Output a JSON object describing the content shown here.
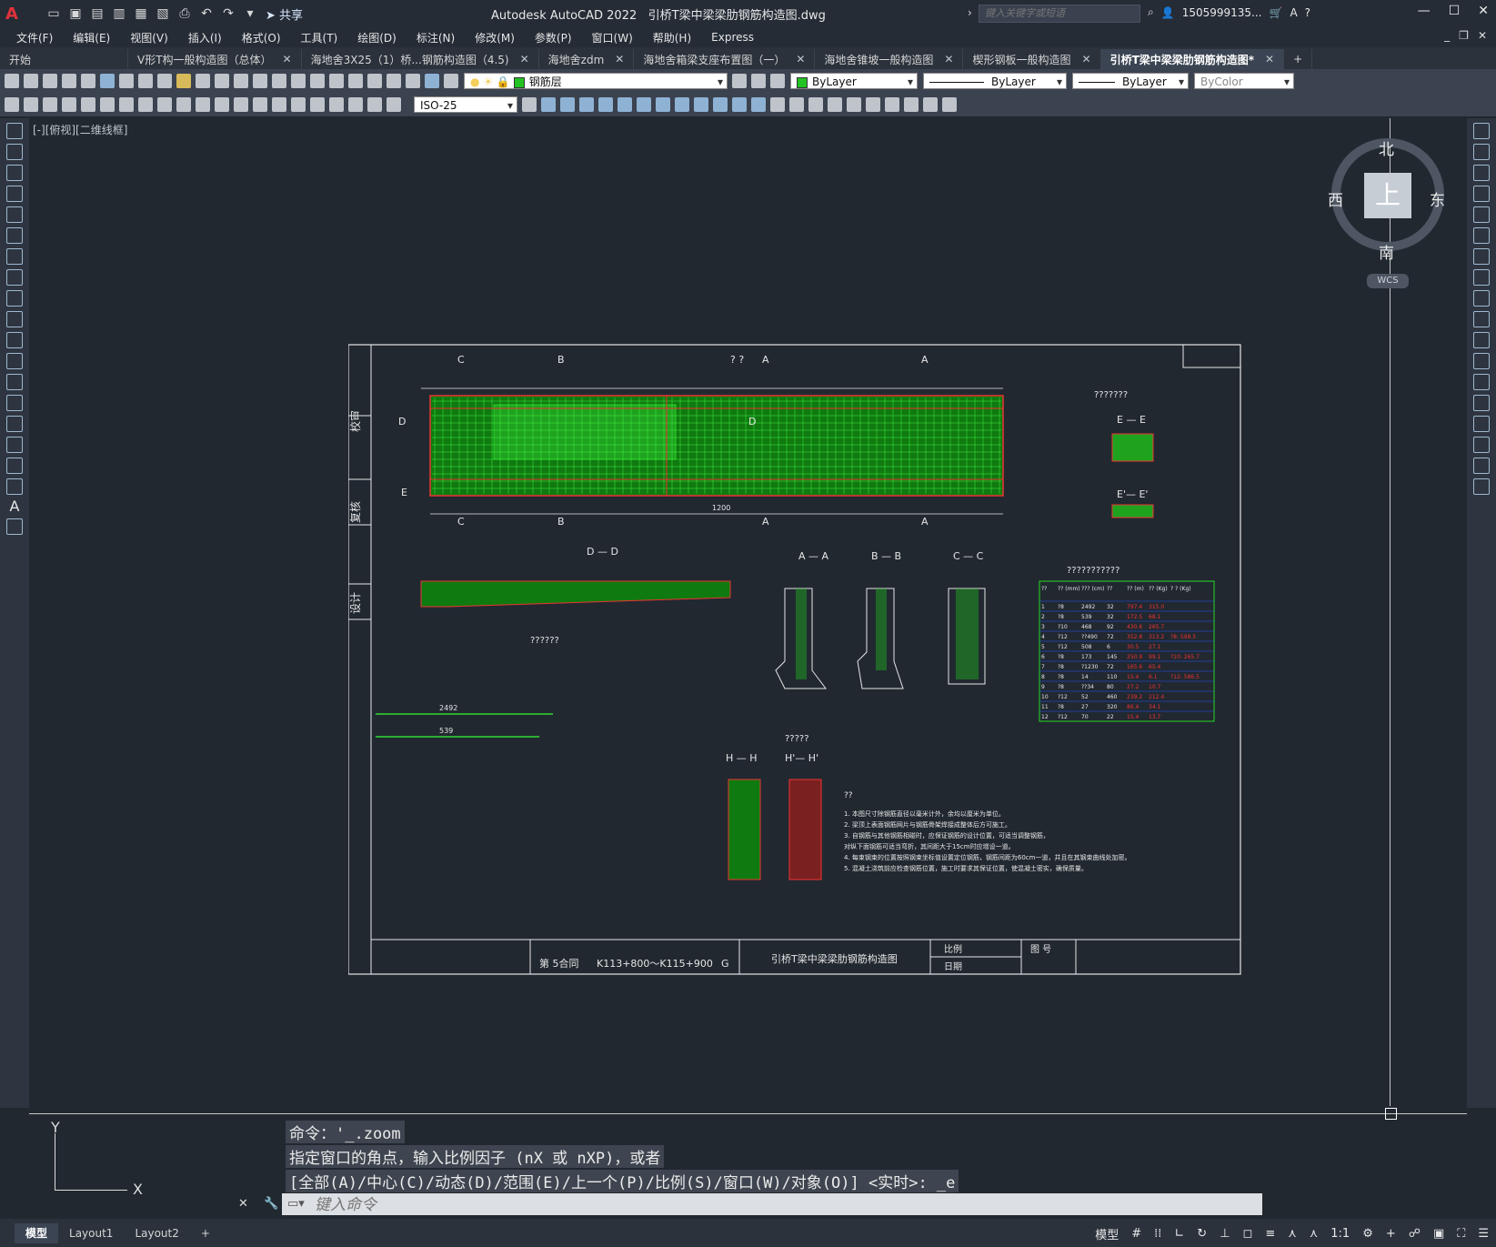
{
  "titlebar": {
    "logo": "A",
    "share": "共享",
    "app_title": "Autodesk AutoCAD 2022",
    "file_title": "引桥T梁中梁梁肋钢筋构造图.dwg",
    "search_placeholder": "键入关键字或短语",
    "user": "1505999135...",
    "qa_icons": [
      "new-icon",
      "open-icon",
      "save-icon",
      "save-as-icon",
      "publish-icon",
      "plot-icon",
      "print-icon",
      "undo-icon",
      "redo-icon",
      "dropdown-icon"
    ]
  },
  "menu": [
    "文件(F)",
    "编辑(E)",
    "视图(V)",
    "插入(I)",
    "格式(O)",
    "工具(T)",
    "绘图(D)",
    "标注(N)",
    "修改(M)",
    "参数(P)",
    "窗口(W)",
    "帮助(H)",
    "Express"
  ],
  "tabs": [
    {
      "label": "开始",
      "closable": false,
      "active": false
    },
    {
      "label": "V形T构一般构造图（总体）",
      "closable": true,
      "active": false
    },
    {
      "label": "海地舍3X25（1）桥...钢筋构造图（4.5)",
      "closable": true,
      "active": false
    },
    {
      "label": "海地舍zdm",
      "closable": true,
      "active": false
    },
    {
      "label": "海地舍箱梁支座布置图（一）",
      "closable": true,
      "active": false
    },
    {
      "label": "海地舍锥坡一般构造图",
      "closable": true,
      "active": false
    },
    {
      "label": "楔形钢板一般构造图",
      "closable": true,
      "active": false
    },
    {
      "label": "引桥T梁中梁梁肋钢筋构造图*",
      "closable": true,
      "active": true
    }
  ],
  "toolbar": {
    "layer": "钢筋层",
    "color": "ByLayer",
    "linetype": "ByLayer",
    "lineweight": "ByLayer",
    "plotstyle": "ByColor",
    "dimstyle": "ISO-25",
    "layer_color": "#22c322"
  },
  "viewport": {
    "label": "[-][俯视][二维线框]"
  },
  "viewcube": {
    "north": "北",
    "south": "南",
    "east": "东",
    "west": "西",
    "top": "上",
    "wcs": "WCS"
  },
  "drawing": {
    "title_top": "? ?",
    "section_ee": "E — E",
    "section_ee2": "E'— E'",
    "section_dd": "D — D",
    "section_aa": "A — A",
    "section_bb": "B — B",
    "section_cc": "C — C",
    "section_hh": "H — H",
    "section_hh2": "H'— H'",
    "q_label1": "???????",
    "q_label2": "??????",
    "q_label3": "?????",
    "q_label4": "???????????",
    "side_labels": [
      "校审",
      "复核",
      "设计"
    ],
    "dim_1200": "1200",
    "dim_2492": "2492",
    "dim_539": "539",
    "title_block": {
      "contract": "第 5合同",
      "range": "K113+800～K115+900",
      "grade": "G",
      "name": "引桥T梁中梁梁肋钢筋构造图",
      "scale_label": "比例",
      "date_label": "日期",
      "drawing_no_label": "图  号"
    },
    "notes_title": "??",
    "notes": [
      "1. 本图尺寸除钢筋直径以毫米计外，余均以厘米为单位。",
      "2. 梁顶上表面钢筋网片与钢筋骨架焊接成整体后方可施工。",
      "3. 自钢筋与其他钢筋相碰时，应保证钢筋的设计位置，可适当调整钢筋，",
      "   对纵下面钢筋可适当弯折，其间距大于15cm时应增设一道。",
      "4. 每束钢束的位置按照钢束坐标值设置定位钢筋，钢筋间距为60cm一道，并且在其钢束曲线处加密。",
      "5. 混凝土浇筑前应检查钢筋位置，施工时要求其保证位置，使混凝土密实，确保质量。"
    ],
    "table": {
      "headers": [
        "??",
        "??\n(mm)",
        "???\n(cm)",
        "??",
        "??\n(m)",
        "??\n(Kg)",
        "?  ?\n(Kg)"
      ],
      "rows": [
        [
          "1",
          "?8",
          "2492",
          "32",
          "797.4",
          "315.0",
          ""
        ],
        [
          "2",
          "?8",
          "539",
          "32",
          "172.5",
          "68.1",
          ""
        ],
        [
          "3",
          "?10",
          "468",
          "92",
          "430.6",
          "265.7",
          ""
        ],
        [
          "4",
          "?12",
          "??490",
          "72",
          "352.8",
          "313.2",
          "?8: 598.5"
        ],
        [
          "5",
          "?12",
          "508",
          "6",
          "30.5",
          "27.1",
          ""
        ],
        [
          "6",
          "?8",
          "173",
          "145",
          "250.9",
          "99.1",
          "?10: 265.7"
        ],
        [
          "7",
          "?8",
          "?1230",
          "72",
          "165.6",
          "65.4",
          ""
        ],
        [
          "8",
          "?8",
          "14",
          "110",
          "15.4",
          "6.1",
          "?12: 586.5"
        ],
        [
          "9",
          "?8",
          "??34",
          "80",
          "27.2",
          "10.7",
          ""
        ],
        [
          "10",
          "?12",
          "52",
          "460",
          "239.2",
          "212.4",
          ""
        ],
        [
          "11",
          "?8",
          "27",
          "320",
          "86.4",
          "34.1",
          ""
        ],
        [
          "12",
          "?12",
          "70",
          "22",
          "15.4",
          "13.7",
          ""
        ]
      ]
    }
  },
  "command": {
    "line1": "命令：'_.zoom",
    "line2": "指定窗口的角点，输入比例因子 (nX 或 nXP)，或者",
    "line3": "[全部(A)/中心(C)/动态(D)/范围(E)/上一个(P)/比例(S)/窗口(W)/对象(O)] <实时>: _e",
    "placeholder": "键入命令"
  },
  "status": {
    "tabs": [
      "模型",
      "Layout1",
      "Layout2"
    ],
    "add": "+",
    "mode": "模型",
    "scale": "1:1"
  },
  "ucs": {
    "x": "X",
    "y": "Y"
  }
}
